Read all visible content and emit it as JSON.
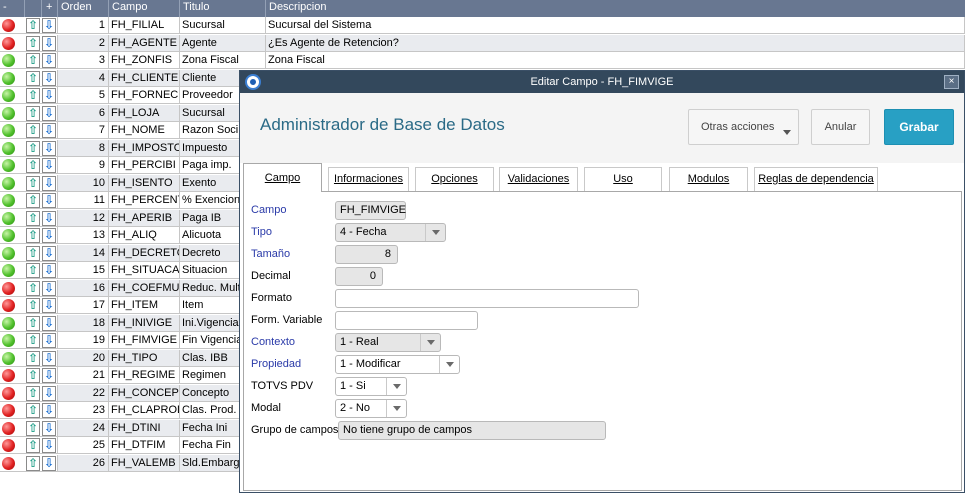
{
  "grid": {
    "columns": [
      "-",
      "+",
      "Orden",
      "Campo",
      "Titulo",
      "Descripcion"
    ],
    "rows": [
      {
        "status": "red",
        "order": "1",
        "campo": "FH_FILIAL",
        "titulo": "Sucursal",
        "desc": "Sucursal del Sistema"
      },
      {
        "status": "red",
        "order": "2",
        "campo": "FH_AGENTE",
        "titulo": "Agente",
        "desc": "¿Es Agente de Retencion?"
      },
      {
        "status": "green",
        "order": "3",
        "campo": "FH_ZONFIS",
        "titulo": "Zona Fiscal",
        "desc": "Zona Fiscal"
      },
      {
        "status": "green",
        "order": "4",
        "campo": "FH_CLIENTE",
        "titulo": "Cliente",
        "desc": ""
      },
      {
        "status": "green",
        "order": "5",
        "campo": "FH_FORNECE",
        "titulo": "Proveedor",
        "desc": ""
      },
      {
        "status": "green",
        "order": "6",
        "campo": "FH_LOJA",
        "titulo": "Sucursal",
        "desc": ""
      },
      {
        "status": "green",
        "order": "7",
        "campo": "FH_NOME",
        "titulo": "Razon Soci",
        "desc": ""
      },
      {
        "status": "green",
        "order": "8",
        "campo": "FH_IMPOSTO",
        "titulo": "Impuesto",
        "desc": ""
      },
      {
        "status": "green",
        "order": "9",
        "campo": "FH_PERCIBI",
        "titulo": "Paga imp.",
        "desc": ""
      },
      {
        "status": "green",
        "order": "10",
        "campo": "FH_ISENTO",
        "titulo": "Exento",
        "desc": ""
      },
      {
        "status": "green",
        "order": "11",
        "campo": "FH_PERCENT",
        "titulo": "% Exencion",
        "desc": ""
      },
      {
        "status": "green",
        "order": "12",
        "campo": "FH_APERIB",
        "titulo": "Paga IB",
        "desc": ""
      },
      {
        "status": "green",
        "order": "13",
        "campo": "FH_ALIQ",
        "titulo": "Alicuota",
        "desc": ""
      },
      {
        "status": "green",
        "order": "14",
        "campo": "FH_DECRETO",
        "titulo": "Decreto",
        "desc": ""
      },
      {
        "status": "green",
        "order": "15",
        "campo": "FH_SITUACA",
        "titulo": "Situacion",
        "desc": ""
      },
      {
        "status": "red",
        "order": "16",
        "campo": "FH_COEFMUL",
        "titulo": "Reduc. Mult",
        "desc": ""
      },
      {
        "status": "red",
        "order": "17",
        "campo": "FH_ITEM",
        "titulo": "Item",
        "desc": ""
      },
      {
        "status": "green",
        "order": "18",
        "campo": "FH_INIVIGE",
        "titulo": "Ini.Vigencia",
        "desc": ""
      },
      {
        "status": "green",
        "order": "19",
        "campo": "FH_FIMVIGE",
        "titulo": "Fin Vigencia",
        "desc": ""
      },
      {
        "status": "green",
        "order": "20",
        "campo": "FH_TIPO",
        "titulo": "Clas. IBB",
        "desc": ""
      },
      {
        "status": "red",
        "order": "21",
        "campo": "FH_REGIME",
        "titulo": "Regimen",
        "desc": ""
      },
      {
        "status": "red",
        "order": "22",
        "campo": "FH_CONCEP",
        "titulo": "Concepto",
        "desc": ""
      },
      {
        "status": "red",
        "order": "23",
        "campo": "FH_CLAPROD",
        "titulo": "Clas. Prod.",
        "desc": ""
      },
      {
        "status": "red",
        "order": "24",
        "campo": "FH_DTINI",
        "titulo": "Fecha Ini",
        "desc": ""
      },
      {
        "status": "red",
        "order": "25",
        "campo": "FH_DTFIM",
        "titulo": "Fecha Fin",
        "desc": ""
      },
      {
        "status": "red",
        "order": "26",
        "campo": "FH_VALEMB",
        "titulo": "Sld.Embarge",
        "desc": ""
      }
    ],
    "status_colors": {
      "green": "#4fc02b",
      "red": "#e02020"
    },
    "arrow_icons": {
      "up": "⇧",
      "down": "⇩"
    }
  },
  "modal": {
    "title": "Editar Campo - FH_FIMVIGE",
    "close_glyph": "×",
    "header_title": "Administrador de Base de Datos",
    "buttons": {
      "otras": "Otras acciones",
      "anular": "Anular",
      "grabar": "Grabar"
    },
    "tabs": [
      "Campo",
      "Informaciones",
      "Opciones",
      "Validaciones",
      "Uso",
      "Modulos",
      "Reglas de dependencia"
    ],
    "active_tab": "Campo",
    "fields": {
      "campo": {
        "label": "Campo",
        "value": "FH_FIMVIGE"
      },
      "tipo": {
        "label": "Tipo",
        "value": "4 - Fecha"
      },
      "tamano": {
        "label": "Tamaño",
        "value": "8"
      },
      "decimal": {
        "label": "Decimal",
        "value": "0"
      },
      "formato": {
        "label": "Formato",
        "value": ""
      },
      "form_variable": {
        "label": "Form. Variable",
        "value": ""
      },
      "contexto": {
        "label": "Contexto",
        "value": "1 - Real"
      },
      "propiedad": {
        "label": "Propiedad",
        "value": "1 - Modificar"
      },
      "totvs_pdv": {
        "label": "TOTVS PDV",
        "value": "1 - Si"
      },
      "modal": {
        "label": "Modal",
        "value": "2 - No"
      },
      "grupo": {
        "label": "Grupo de campos",
        "value": "No tiene grupo de campos"
      }
    },
    "colors": {
      "titlebar": "#33485c",
      "accent": "#28a0c4",
      "header_text": "#2a6a86",
      "required_label": "#2a3aa8"
    }
  }
}
